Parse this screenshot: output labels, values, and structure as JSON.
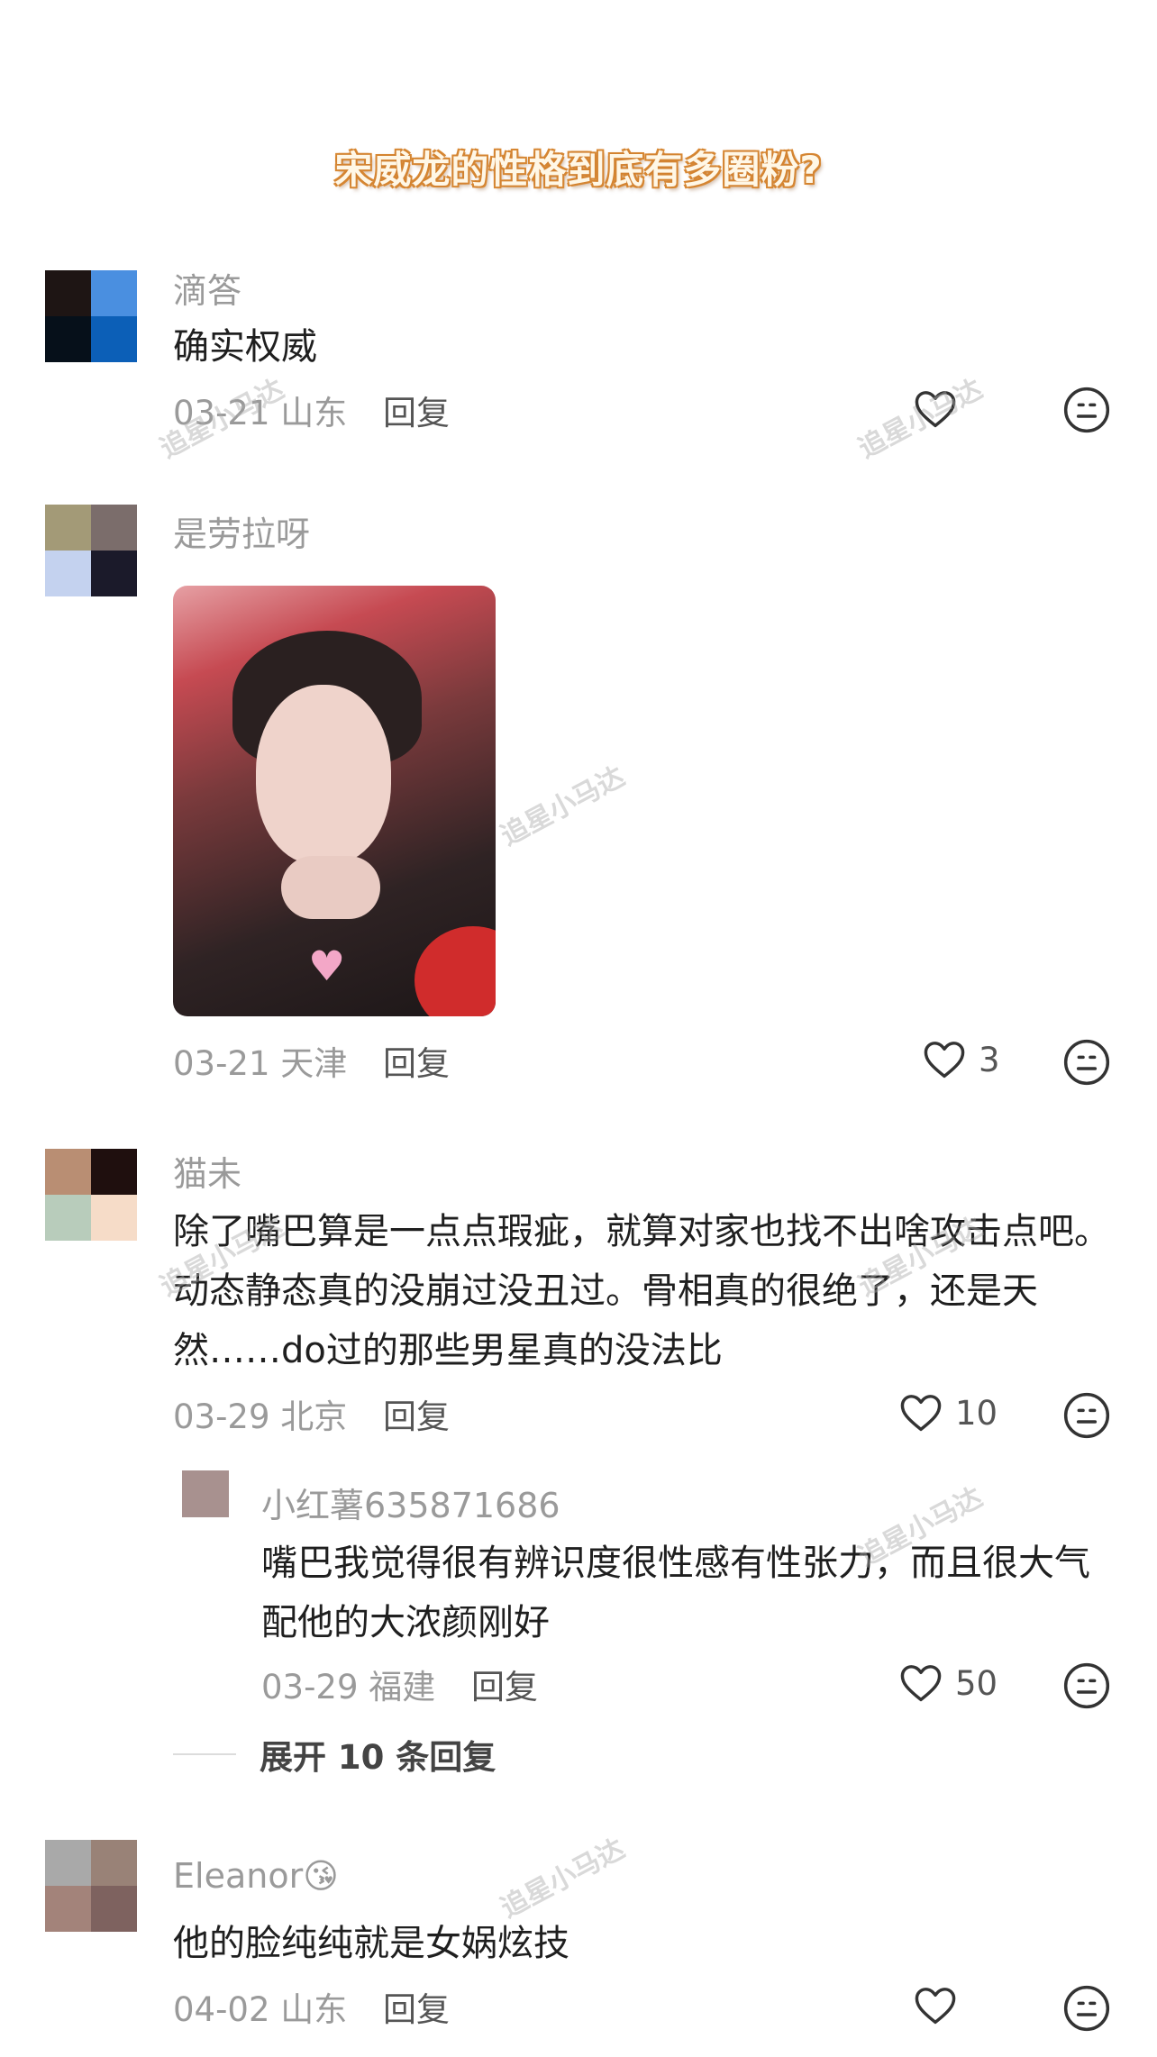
{
  "title": "宋威龙的性格到底有多圈粉?",
  "watermark": "追星小马达",
  "comments": [
    {
      "username": "滴答",
      "content": "确实权威",
      "date": "03-21",
      "location": "山东",
      "reply_label": "回复",
      "likes": "",
      "avatar_colors": [
        "#1e1514",
        "#4a8fe0",
        "#06101a",
        "#0c5fb7"
      ]
    },
    {
      "username": "是劳拉呀",
      "content": "",
      "date": "03-21",
      "location": "天津",
      "reply_label": "回复",
      "likes": "3",
      "avatar_colors": [
        "#a39a77",
        "#7b6d6b",
        "#c4d2ef",
        "#1b1a2a"
      ],
      "image_heart_text": "Love"
    },
    {
      "username": "猫未",
      "content": "除了嘴巴算是一点点瑕疵，就算对家也找不出啥攻击点吧。动态静态真的没崩过没丑过。骨相真的很绝了，还是天然……do过的那些男星真的没法比",
      "date": "03-29",
      "location": "北京",
      "reply_label": "回复",
      "likes": "10",
      "avatar_colors": [
        "#b98e73",
        "#1f0f0e",
        "#b8ccbb",
        "#f6dcc8"
      ]
    },
    {
      "username": "小红薯635871686",
      "content": "嘴巴我觉得很有辨识度很性感有性张力，而且很大气配他的大浓颜刚好",
      "date": "03-29",
      "location": "福建",
      "reply_label": "回复",
      "likes": "50",
      "avatar_colors": [
        "#a8918f"
      ]
    },
    {
      "username": "Eleanor😘",
      "content": "他的脸纯纯就是女娲炫技",
      "date": "04-02",
      "location": "山东",
      "reply_label": "回复",
      "likes": "",
      "avatar_colors": [
        "#a9a9a9",
        "#998277",
        "#a3837a",
        "#7e625f"
      ]
    }
  ],
  "expand_replies": "展开 10 条回复",
  "icons": {
    "like": "heart-outline-icon",
    "face": "neutral-face-icon"
  }
}
